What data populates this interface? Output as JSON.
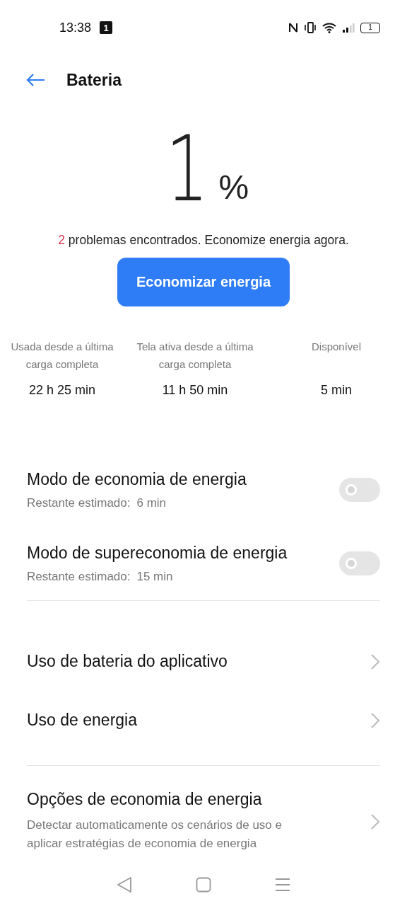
{
  "status_bar": {
    "time": "13:38",
    "notification_count": "1",
    "battery": "1"
  },
  "header": {
    "title": "Bateria"
  },
  "battery_level": {
    "value": "1",
    "unit": "%"
  },
  "problems": {
    "count": "2",
    "text": "problemas encontrados. Economize energia agora."
  },
  "save_button": "Economizar energia",
  "stats": [
    {
      "label": "Usada desde a última carga completa",
      "value": "22 h 25 min"
    },
    {
      "label": "Tela ativa desde a última carga completa",
      "value": "11 h 50 min"
    },
    {
      "label": "Disponível",
      "value": "5 min"
    }
  ],
  "modes": [
    {
      "title": "Modo de economia de energia",
      "label": "Restante estimado:",
      "value": "6 min",
      "on": false
    },
    {
      "title": "Modo de supereconomia de energia",
      "label": "Restante estimado:",
      "value": "15 min",
      "on": false
    }
  ],
  "links": [
    {
      "title": "Uso de bateria do aplicativo"
    },
    {
      "title": "Uso de energia"
    }
  ],
  "options": {
    "title": "Opções de economia de energia",
    "description": "Detectar automaticamente os cenários de uso e aplicar estratégias de economia de energia"
  }
}
